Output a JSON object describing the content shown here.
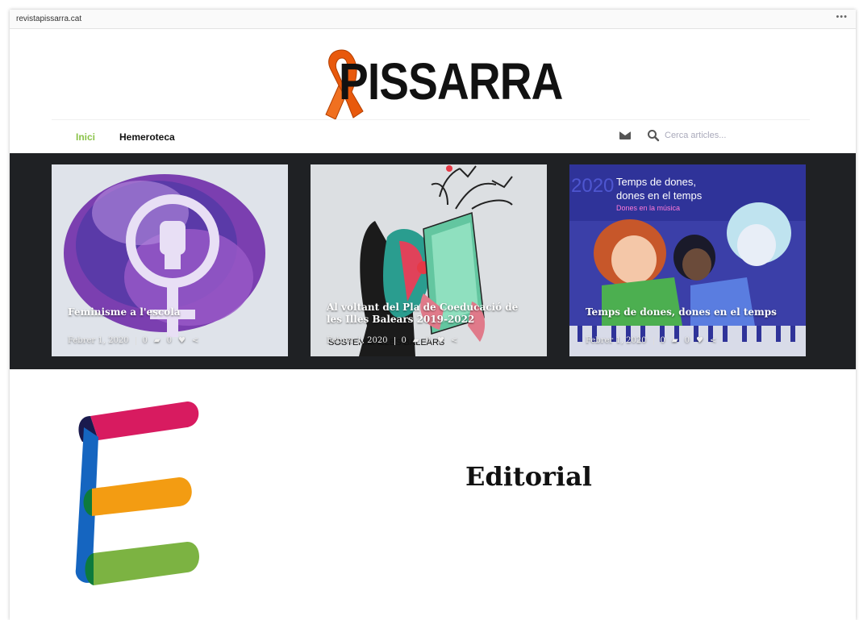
{
  "browser": {
    "url": "revistapissarra.cat",
    "menu_icon": "more-dots-icon"
  },
  "site": {
    "logo_text": "PISSARRA",
    "ribbon_color": "#e8590c"
  },
  "nav": {
    "items": [
      {
        "label": "Inici",
        "active": true
      },
      {
        "label": "Hemeroteca",
        "active": false
      }
    ],
    "mail_icon": "mail-icon",
    "search_icon": "search-icon",
    "search_placeholder": "Cerca articles..."
  },
  "featured": [
    {
      "title": "Feminisme a l'escola",
      "date": "Febrer 1, 2020",
      "comments": "0",
      "likes": "0",
      "icons": [
        "comment-icon",
        "heart-icon",
        "share-icon"
      ]
    },
    {
      "title": "Al voltant del Pla de Coeducació de les Illes Balears 2019-2022",
      "date": "Febrer 1, 2020",
      "comments": "0",
      "likes": "0",
      "image_text": "SOSTENIM ILLES BALEARS",
      "icons": [
        "comment-icon",
        "heart-icon",
        "share-icon"
      ]
    },
    {
      "title": "Temps de dones, dones en el temps",
      "date": "Febrer 1, 2020",
      "comments": "0",
      "likes": "0",
      "image_year": "2020",
      "image_headline": "Temps de dones, dones en el temps",
      "image_subtitle": "Dones en la música",
      "icons": [
        "comment-icon",
        "heart-icon",
        "share-icon"
      ]
    }
  ],
  "section": {
    "title": "Editorial",
    "logo_colors": [
      "#d81b60",
      "#1565c0",
      "#f39c12",
      "#7cb342",
      "#1a1a4e"
    ]
  }
}
